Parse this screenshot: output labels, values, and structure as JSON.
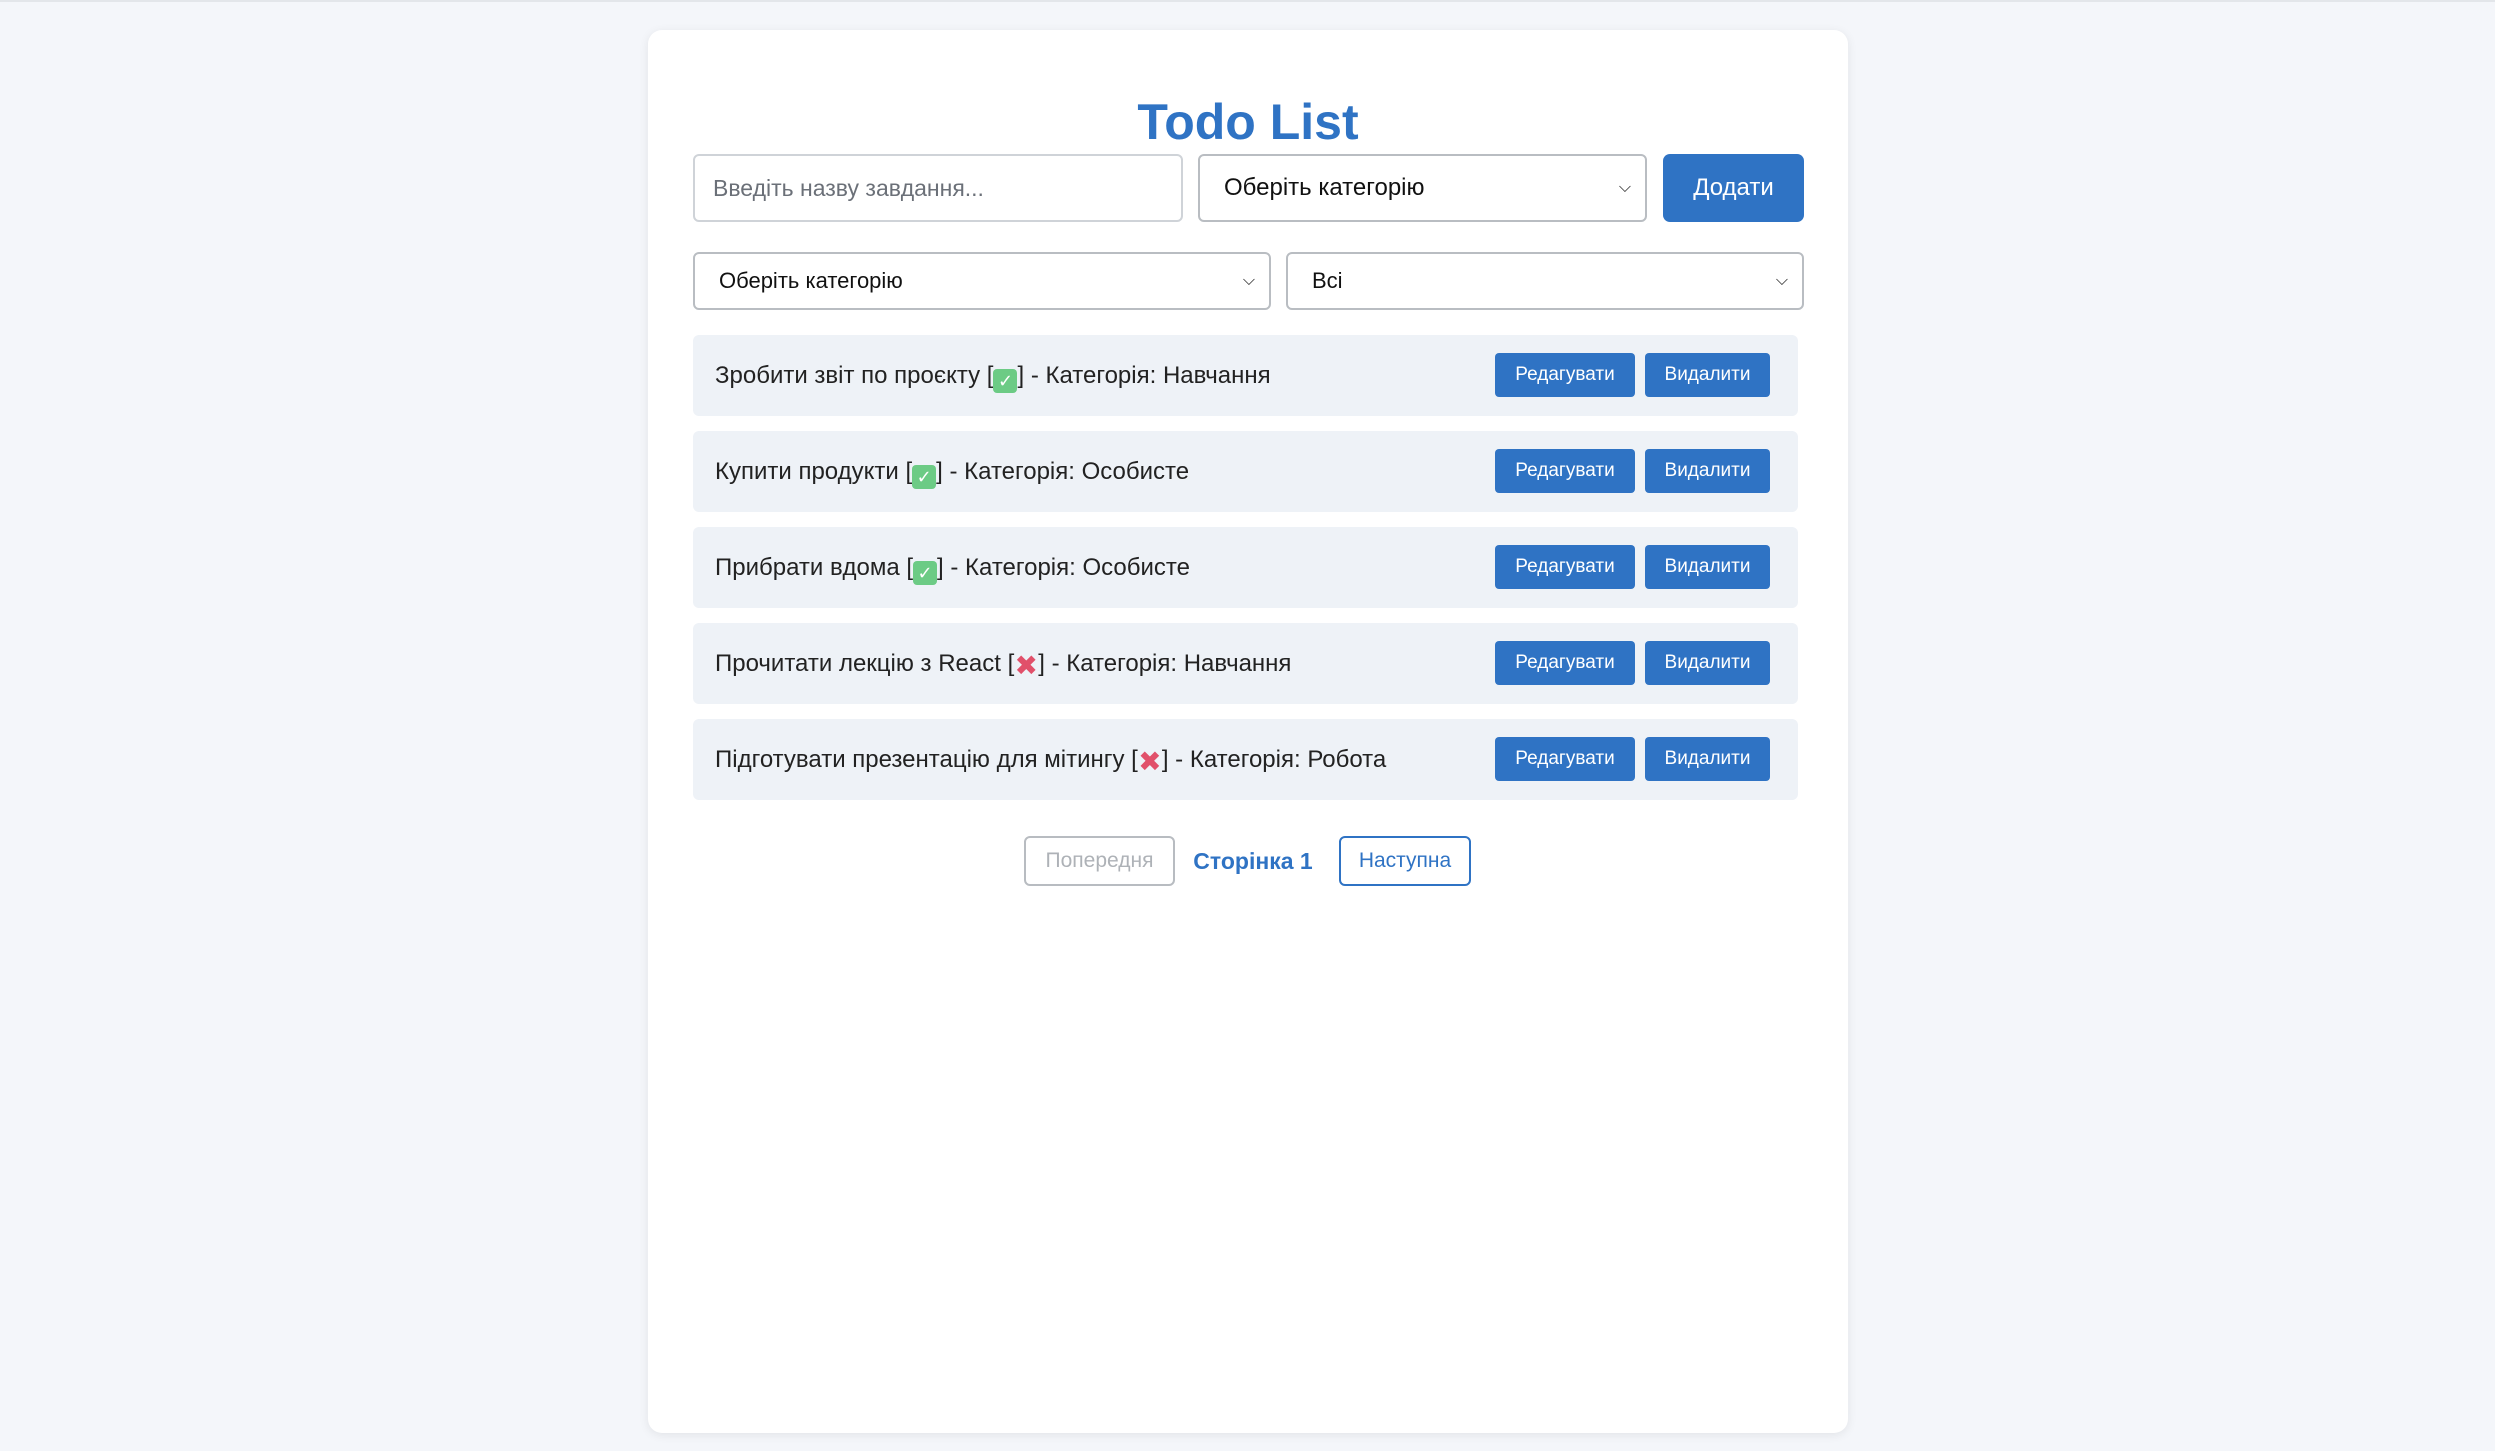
{
  "app": {
    "title": "Todo List"
  },
  "form": {
    "task_placeholder": "Введіть назву завдання...",
    "category_select": "Оберіть категорію",
    "add_label": "Додати"
  },
  "filters": {
    "category_filter": "Оберіть категорію",
    "status_filter": "Всі"
  },
  "todos": [
    {
      "title": "Зробити звіт по проєкту",
      "status_icon": "check-mark",
      "done": true,
      "category_label": "Категорія:",
      "category": "Навчання",
      "edit_label": "Редагувати",
      "delete_label": "Видалити"
    },
    {
      "title": "Купити продукти",
      "status_icon": "check-mark",
      "done": true,
      "category_label": "Категорія:",
      "category": "Особисте",
      "edit_label": "Редагувати",
      "delete_label": "Видалити"
    },
    {
      "title": "Прибрати вдома",
      "status_icon": "check-mark",
      "done": true,
      "category_label": "Категорія:",
      "category": "Особисте",
      "edit_label": "Редагувати",
      "delete_label": "Видалити"
    },
    {
      "title": "Прочитати лекцію з React",
      "status_icon": "cross-mark",
      "done": false,
      "category_label": "Категорія:",
      "category": "Навчання",
      "edit_label": "Редагувати",
      "delete_label": "Видалити"
    },
    {
      "title": "Підготувати презентацію для мітингу",
      "status_icon": "cross-mark",
      "done": false,
      "category_label": "Категорія:",
      "category": "Робота",
      "edit_label": "Редагувати",
      "delete_label": "Видалити"
    }
  ],
  "pagination": {
    "prev_label": "Попередня",
    "page_label": "Сторінка 1",
    "next_label": "Наступна"
  },
  "colors": {
    "accent": "#2f73c4",
    "row_bg": "#eef2f7",
    "page_bg": "#f4f6fa",
    "done": "#6ccb85",
    "undone": "#e1506a"
  }
}
